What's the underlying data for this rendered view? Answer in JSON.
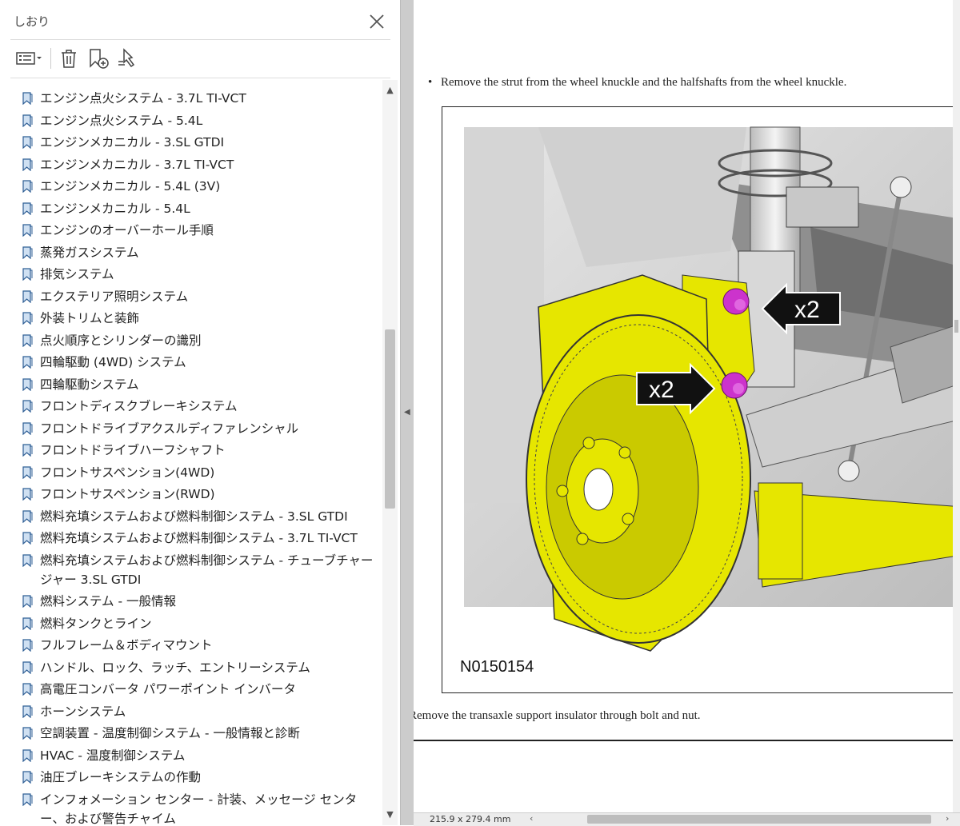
{
  "panel": {
    "title": "しおり",
    "toolbar": {
      "options_icon": "options-menu-icon",
      "delete_icon": "trash-icon",
      "new_bookmark_icon": "new-bookmark-icon",
      "find_bookmark_icon": "find-current-bookmark-icon"
    },
    "items": [
      {
        "label": "エンジン点火システム - 3.7L TI-VCT"
      },
      {
        "label": "エンジン点火システム - 5.4L"
      },
      {
        "label": "エンジンメカニカル - 3.SL GTDI"
      },
      {
        "label": "エンジンメカニカル - 3.7L TI-VCT"
      },
      {
        "label": "エンジンメカニカル - 5.4L (3V)"
      },
      {
        "label": "エンジンメカニカル - 5.4L"
      },
      {
        "label": "エンジンのオーバーホール手順"
      },
      {
        "label": "蒸発ガスシステム"
      },
      {
        "label": "排気システム"
      },
      {
        "label": "エクステリア照明システム"
      },
      {
        "label": "外装トリムと装飾"
      },
      {
        "label": "点火順序とシリンダーの識別"
      },
      {
        "label": "四輪駆動 (4WD) システム"
      },
      {
        "label": "四輪駆動システム"
      },
      {
        "label": "フロントディスクブレーキシステム"
      },
      {
        "label": "フロントドライブアクスルディファレンシャル"
      },
      {
        "label": "フロントドライブハーフシャフト"
      },
      {
        "label": "フロントサスペンション(4WD)"
      },
      {
        "label": "フロントサスペンション(RWD)"
      },
      {
        "label": "燃料充填システムおよび燃料制御システム - 3.SL GTDI"
      },
      {
        "label": "燃料充填システムおよび燃料制御システム - 3.7L TI-VCT"
      },
      {
        "label": "燃料充填システムおよび燃料制御システム - チューブチャージャー 3.SL GTDI"
      },
      {
        "label": "燃料システム - 一般情報"
      },
      {
        "label": "燃料タンクとライン"
      },
      {
        "label": "フルフレーム＆ボディマウント"
      },
      {
        "label": "ハンドル、ロック、ラッチ、エントリーシステム"
      },
      {
        "label": "高電圧コンバータ パワーポイント インバータ"
      },
      {
        "label": "ホーンシステム"
      },
      {
        "label": "空調装置 - 温度制御システム - 一般情報と診断"
      },
      {
        "label": "HVAC - 温度制御システム"
      },
      {
        "label": "油圧ブレーキシステムの作動"
      },
      {
        "label": "インフォメーション センター - 計装、メッセージ センター、および警告チャイム"
      }
    ]
  },
  "document": {
    "bullet": "•",
    "step1": "Remove the strut from the wheel knuckle and the halfshafts from the wheel knuckle.",
    "figure": {
      "callout1": "x2",
      "callout2": "x2",
      "figure_id": "N0150154"
    },
    "step2": "Remove the transaxle support insulator through bolt and nut."
  },
  "status": {
    "page_size": "215.9 x 279.4 mm"
  },
  "colors": {
    "highlight_part": "#e6e600",
    "fastener": "#cc33cc",
    "panel_bg": "#ffffff"
  }
}
